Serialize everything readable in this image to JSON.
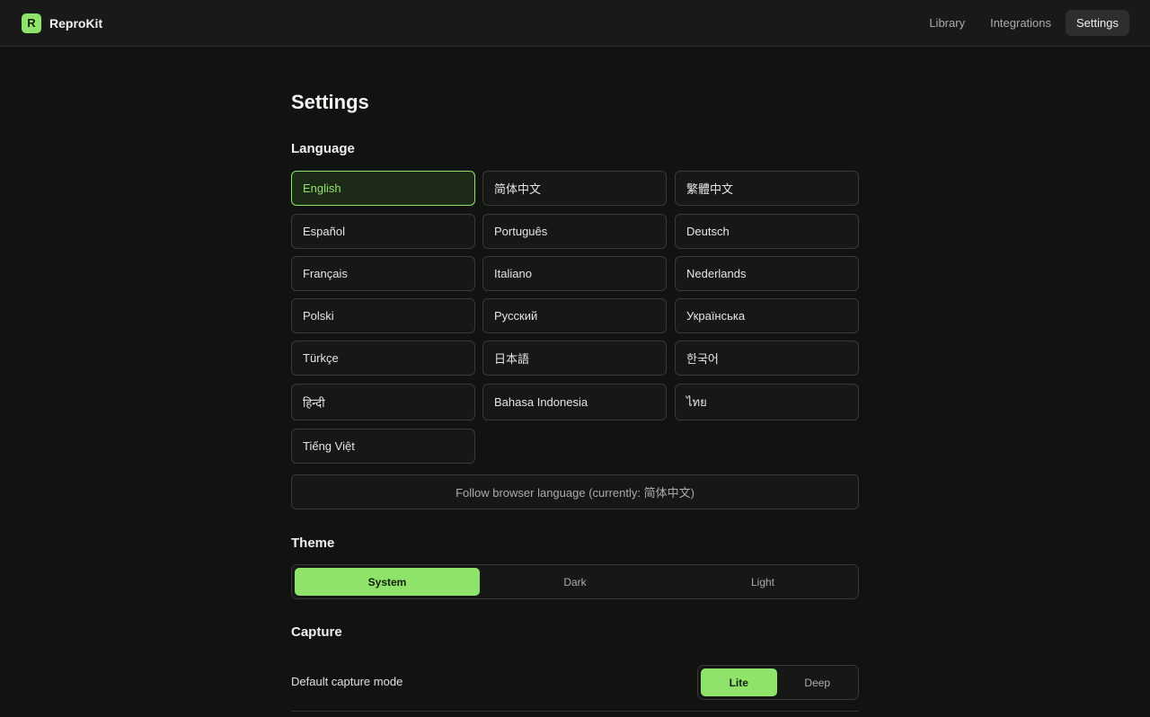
{
  "app": {
    "name": "ReproKit",
    "logo_letter": "R"
  },
  "nav": [
    {
      "label": "Library",
      "active": false
    },
    {
      "label": "Integrations",
      "active": false
    },
    {
      "label": "Settings",
      "active": true
    }
  ],
  "page": {
    "title": "Settings"
  },
  "language": {
    "heading": "Language",
    "options": [
      {
        "label": "English",
        "active": true
      },
      {
        "label": "简体中文",
        "active": false
      },
      {
        "label": "繁體中文",
        "active": false
      },
      {
        "label": "Español",
        "active": false
      },
      {
        "label": "Português",
        "active": false
      },
      {
        "label": "Deutsch",
        "active": false
      },
      {
        "label": "Français",
        "active": false
      },
      {
        "label": "Italiano",
        "active": false
      },
      {
        "label": "Nederlands",
        "active": false
      },
      {
        "label": "Polski",
        "active": false
      },
      {
        "label": "Русский",
        "active": false
      },
      {
        "label": "Українська",
        "active": false
      },
      {
        "label": "Türkçe",
        "active": false
      },
      {
        "label": "日本語",
        "active": false
      },
      {
        "label": "한국어",
        "active": false
      },
      {
        "label": "हिन्दी",
        "active": false
      },
      {
        "label": "Bahasa Indonesia",
        "active": false
      },
      {
        "label": "ไทย",
        "active": false
      },
      {
        "label": "Tiếng Việt",
        "active": false
      }
    ],
    "follow_browser_label": "Follow browser language (currently: 简体中文)"
  },
  "theme": {
    "heading": "Theme",
    "options": [
      {
        "label": "System",
        "active": true
      },
      {
        "label": "Dark",
        "active": false
      },
      {
        "label": "Light",
        "active": false
      }
    ]
  },
  "capture": {
    "heading": "Capture",
    "default_mode_label": "Default capture mode",
    "modes": [
      {
        "label": "Lite",
        "active": true
      },
      {
        "label": "Deep",
        "active": false
      }
    ]
  },
  "colors": {
    "accent": "#8fe36a",
    "background": "#111311",
    "surface": "#181a18"
  }
}
